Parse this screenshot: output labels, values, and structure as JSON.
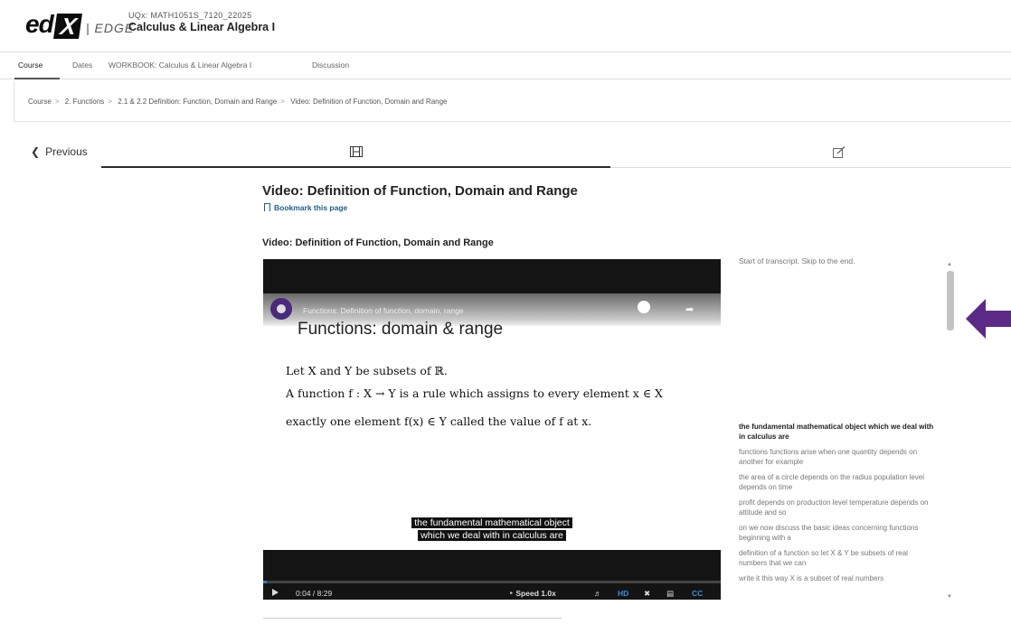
{
  "header": {
    "logo_text": "edX",
    "edge_label": "| EDGE",
    "course_code": "UQx: MATH1051S_7120_22025",
    "course_name": "Calculus & Linear Algebra I"
  },
  "nav": {
    "tabs": [
      {
        "label": "Course",
        "active": true
      },
      {
        "label": "Dates",
        "active": false
      },
      {
        "label": "WORKBOOK: Calculus & Linear Algebra I",
        "active": false
      },
      {
        "label": "Discussion",
        "active": false
      }
    ]
  },
  "breadcrumb": [
    "Course",
    "2. Functions",
    "2.1 & 2.2 Definition: Function, Domain and Range",
    "Video: Definition of Function, Domain and Range"
  ],
  "sequence": {
    "previous_label": "Previous",
    "icons": [
      "film-icon",
      "edit-icon"
    ]
  },
  "unit": {
    "title": "Video: Definition of Function, Domain and Range",
    "bookmark_label": "Bookmark this page",
    "video_heading": "Video: Definition of Function, Domain and Range"
  },
  "video": {
    "youtube_title": "Functions: Definition of function, domain, range",
    "slide_title": "Functions: domain & range",
    "slide_lines": [
      "Let X and Y be subsets of ℝ.",
      "A function f : X → Y is a rule which assigns to every element x ∈ X",
      "exactly one element f(x) ∈ Y called the value of f at x."
    ],
    "caption_line1": "the fundamental mathematical object",
    "caption_line2": "which we deal with in calculus are",
    "time": "0:04 / 8:29",
    "speed_label": "Speed",
    "speed_value": "1.0x",
    "hd_label": "HD",
    "cc_label": "CC",
    "progress": 0.008
  },
  "transcript": {
    "skip_text": "Start of transcript. Skip to the end.",
    "items": [
      {
        "text": "the fundamental mathematical object which we deal with in calculus are",
        "current": true
      },
      {
        "text": "functions functions arise when one quantity depends on another for example",
        "current": false
      },
      {
        "text": "the area of a circle depends on the radius population level depends on time",
        "current": false
      },
      {
        "text": "profit depends on production level temperature depends on attitude and so",
        "current": false
      },
      {
        "text": "on we now discuss the basic ideas concerning functions beginning with a",
        "current": false
      },
      {
        "text": "definition of a function so let X & Y be subsets of real numbers that we can",
        "current": false
      },
      {
        "text": "write it this way X is a subset of real numbers",
        "current": false
      }
    ]
  },
  "colors": {
    "link_blue": "#1a5e8a",
    "player_accent": "#3b8fd9",
    "annotation_arrow": "#5b2a86"
  }
}
